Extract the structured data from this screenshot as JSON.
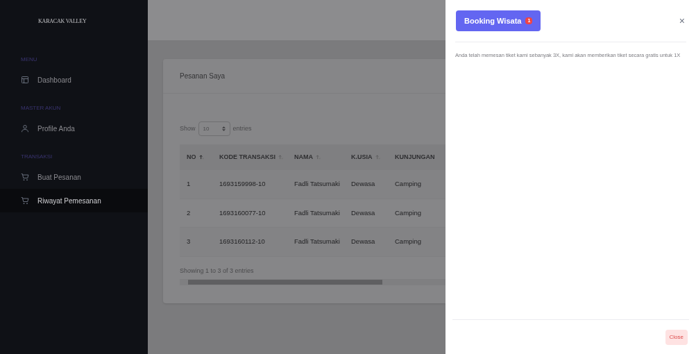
{
  "sidebar": {
    "brand": "KARACAK VALLEY",
    "sections": [
      {
        "heading": "MENU",
        "items": [
          {
            "label": "Dashboard",
            "kind": "layout",
            "selected": false
          }
        ]
      },
      {
        "heading": "MASTER AKUN",
        "items": [
          {
            "label": "Profile Anda",
            "kind": "user",
            "selected": false
          }
        ]
      },
      {
        "heading": "TRANSAKSI",
        "items": [
          {
            "label": "Buat Pesanan",
            "kind": "cart",
            "selected": false
          },
          {
            "label": "Riwayat Pemesanan",
            "kind": "cart",
            "selected": true
          }
        ]
      }
    ]
  },
  "card": {
    "title": "Pesanan Saya",
    "length": {
      "label_before": "Show",
      "value": "10",
      "label_after": "entries"
    },
    "table": {
      "columns": [
        {
          "label": "NO",
          "sorted": true
        },
        {
          "label": "KODE TRANSAKSI",
          "sorted": false
        },
        {
          "label": "NAMA",
          "sorted": false
        },
        {
          "label": "K.USIA",
          "sorted": false
        },
        {
          "label": "KUNJUNGAN"
        }
      ],
      "rows": [
        [
          "1",
          "1693159998-10",
          "Fadli Tatsumaki",
          "Dewasa",
          "Camping"
        ],
        [
          "2",
          "1693160077-10",
          "Fadli Tatsumaki",
          "Dewasa",
          "Camping"
        ],
        [
          "3",
          "1693160112-10",
          "Fadli Tatsumaki",
          "Dewasa",
          "Camping"
        ]
      ]
    },
    "info": "Showing 1 to 3 of 3 entries"
  },
  "modal": {
    "title": "Booking Wisata",
    "badge": "1",
    "close_icon": "×",
    "message": "Anda telah memesan tiket kami sebanyak 3X, kami akan memberikan tiket secara gratis untuk 1X",
    "close_button": "Close"
  }
}
